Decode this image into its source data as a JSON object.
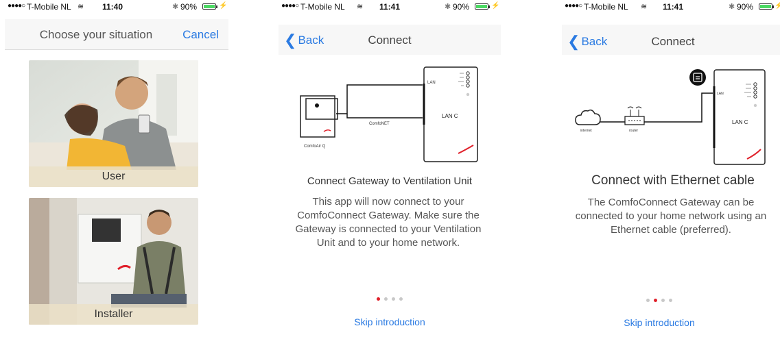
{
  "colors": {
    "accent": "#2a7ae2",
    "active_dot": "#e0202a",
    "battery": "#4cd964"
  },
  "screens": [
    {
      "status": {
        "carrier": "T-Mobile NL",
        "time": "11:40",
        "battery": "90%"
      },
      "nav": {
        "title": "Choose your situation",
        "cancel": "Cancel"
      },
      "options": [
        {
          "label": "User"
        },
        {
          "label": "Installer"
        }
      ]
    },
    {
      "status": {
        "carrier": "T-Mobile NL",
        "time": "11:41",
        "battery": "90%"
      },
      "nav": {
        "back": "Back",
        "title": "Connect"
      },
      "diagram": {
        "device": "ComfoAir Q",
        "cable": "ComfoNET",
        "gateway": "LAN C",
        "port": "LAN"
      },
      "heading": "Connect Gateway to Ventilation Unit",
      "body": "This app will now connect to your ComfoConnect Gateway. Make sure the Gateway is connected to your Ventilation Unit and to your home network.",
      "pager": {
        "pages": 4,
        "current": 1
      },
      "skip": "Skip introduction"
    },
    {
      "status": {
        "carrier": "T-Mobile NL",
        "time": "11:41",
        "battery": "90%"
      },
      "nav": {
        "back": "Back",
        "title": "Connect"
      },
      "diagram": {
        "internet": "internet",
        "router": "router",
        "gateway": "LAN C",
        "port": "LAN"
      },
      "heading": "Connect with Ethernet cable",
      "body": "The ComfoConnect Gateway can be connected to your home network using an Ethernet cable (preferred).",
      "pager": {
        "pages": 4,
        "current": 2
      },
      "skip": "Skip introduction"
    }
  ]
}
